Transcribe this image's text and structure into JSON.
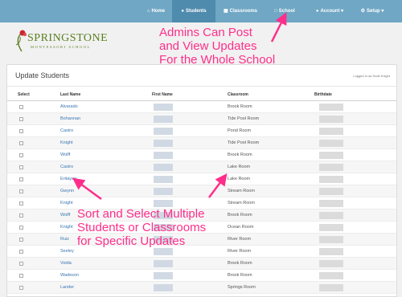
{
  "nav": {
    "items": [
      {
        "label": "Home",
        "icon": "home-icon"
      },
      {
        "label": "Students",
        "icon": "users-icon"
      },
      {
        "label": "Classrooms",
        "icon": "grid-icon"
      },
      {
        "label": "School",
        "icon": "document-icon"
      },
      {
        "label": "Account",
        "icon": "user-icon"
      },
      {
        "label": "Setup",
        "icon": "gear-icon"
      }
    ],
    "active_index": 1
  },
  "logo": {
    "name": "SPRINGSTONE",
    "subtitle": "MONTESSORI SCHOOL"
  },
  "annotations": {
    "top": "Admins Can Post\nand View Updates\nFor the Whole School",
    "bottom": "Sort and Select Multiple\nStudents or Classrooms\nfor Specific Updates"
  },
  "panel": {
    "title": "Update Students",
    "logged_in": "Logged in as Scott Knight",
    "columns": [
      "Select",
      "Last Name",
      "First Name",
      "Classroom",
      "Birthdate"
    ]
  },
  "rows": [
    {
      "last": "Alvarado",
      "room": "Brook Room"
    },
    {
      "last": "Bohannan",
      "room": "Tide Pool Room"
    },
    {
      "last": "Castro",
      "room": "Pond Room"
    },
    {
      "last": "Knight",
      "room": "Tide Pool Room"
    },
    {
      "last": "Wolff",
      "room": "Brook Room"
    },
    {
      "last": "Castro",
      "room": "Lake Room"
    },
    {
      "last": "Eritayan",
      "room": "Lake Room"
    },
    {
      "last": "Gwynn",
      "room": "Stream Room"
    },
    {
      "last": "Knight",
      "room": "Stream Room"
    },
    {
      "last": "Wolff",
      "room": "Brook Room"
    },
    {
      "last": "Knight",
      "room": "Ocean Room"
    },
    {
      "last": "Ruiz",
      "room": "River Room"
    },
    {
      "last": "Seeley",
      "room": "River Room"
    },
    {
      "last": "Voida",
      "room": "Brook Room"
    },
    {
      "last": "Wadeson",
      "room": "Brook Room"
    },
    {
      "last": "Lander",
      "room": "Springs Room"
    }
  ],
  "colors": {
    "nav": "#6fa7c4",
    "nav_active": "#4f8bad",
    "annotation": "#ff2e8a",
    "link": "#3a75b0",
    "logo": "#5a7f1f"
  }
}
